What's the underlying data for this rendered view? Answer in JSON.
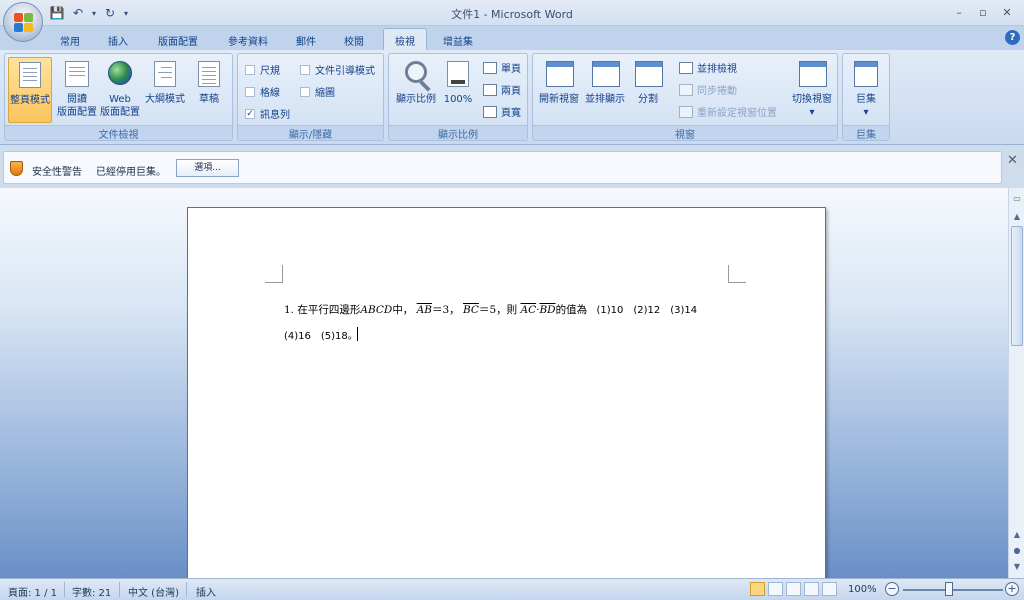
{
  "window": {
    "title": "文件1 - Microsoft Word",
    "controls": [
      "–",
      "▫",
      "✕"
    ]
  },
  "qat": {
    "save": "💾",
    "undo": "↶",
    "redo": "↻",
    "customize": "▾"
  },
  "tabs": [
    "常用",
    "插入",
    "版面配置",
    "參考資料",
    "郵件",
    "校閱",
    "檢視",
    "增益集"
  ],
  "active_tab": "檢視",
  "help": "?",
  "ribbon": {
    "views_group": {
      "label": "文件檢視",
      "buttons": [
        {
          "line1": "整頁模式",
          "line2": ""
        },
        {
          "line1": "閱讀",
          "line2": "版面配置"
        },
        {
          "line1": "Web",
          "line2": "版面配置"
        },
        {
          "line1": "大綱模式",
          "line2": ""
        },
        {
          "line1": "草稿",
          "line2": ""
        }
      ]
    },
    "show_group": {
      "label": "顯示/隱藏",
      "ruler": "尺規",
      "gridlines": "格線",
      "message_bar": "訊息列",
      "doc_map": "文件引導模式",
      "thumbnails": "縮圖",
      "checked_mark": "✓"
    },
    "zoom_group": {
      "label": "顯示比例",
      "zoom": "顯示比例",
      "percent": "100%",
      "one_page": "單頁",
      "two_pages": "兩頁",
      "page_width": "頁寬"
    },
    "window_group": {
      "label": "視窗",
      "new_window": "開新視窗",
      "arrange_all": "並排顯示",
      "split": "分割",
      "side_by_side": "並排檢視",
      "sync_scroll": "同步捲動",
      "reset_position": "重新設定視窗位置",
      "switch_windows": "切換視窗"
    },
    "macros_group": {
      "label": "巨集",
      "macros": "巨集"
    }
  },
  "security_bar": {
    "title": "安全性警告",
    "message": "已經停用巨集。",
    "options_button": "選項...",
    "close": "✕"
  },
  "document": {
    "line1": {
      "prefix": "1. 在平行四邊形",
      "abcd": "ABCD",
      "mid": "中，",
      "ab": "AB",
      "eq3": "＝3，",
      "bc": "BC",
      "eq5": "＝5，則",
      "ac": "AC",
      "dot": "·",
      "bd": "BD",
      "suffix": "的值為",
      "options": "(1)10　(2)12　(3)14"
    },
    "line2": "(4)16　(5)18。"
  },
  "statusbar": {
    "page": "頁面: 1 / 1",
    "words": "字數: 21",
    "language": "中文 (台灣)",
    "mode": "插入",
    "zoom": "100%",
    "zoom_out": "−",
    "zoom_in": "+"
  },
  "scrollbar": {
    "up": "▲",
    "down": "▼",
    "prev": "▲",
    "select": "●",
    "next": "▼"
  }
}
